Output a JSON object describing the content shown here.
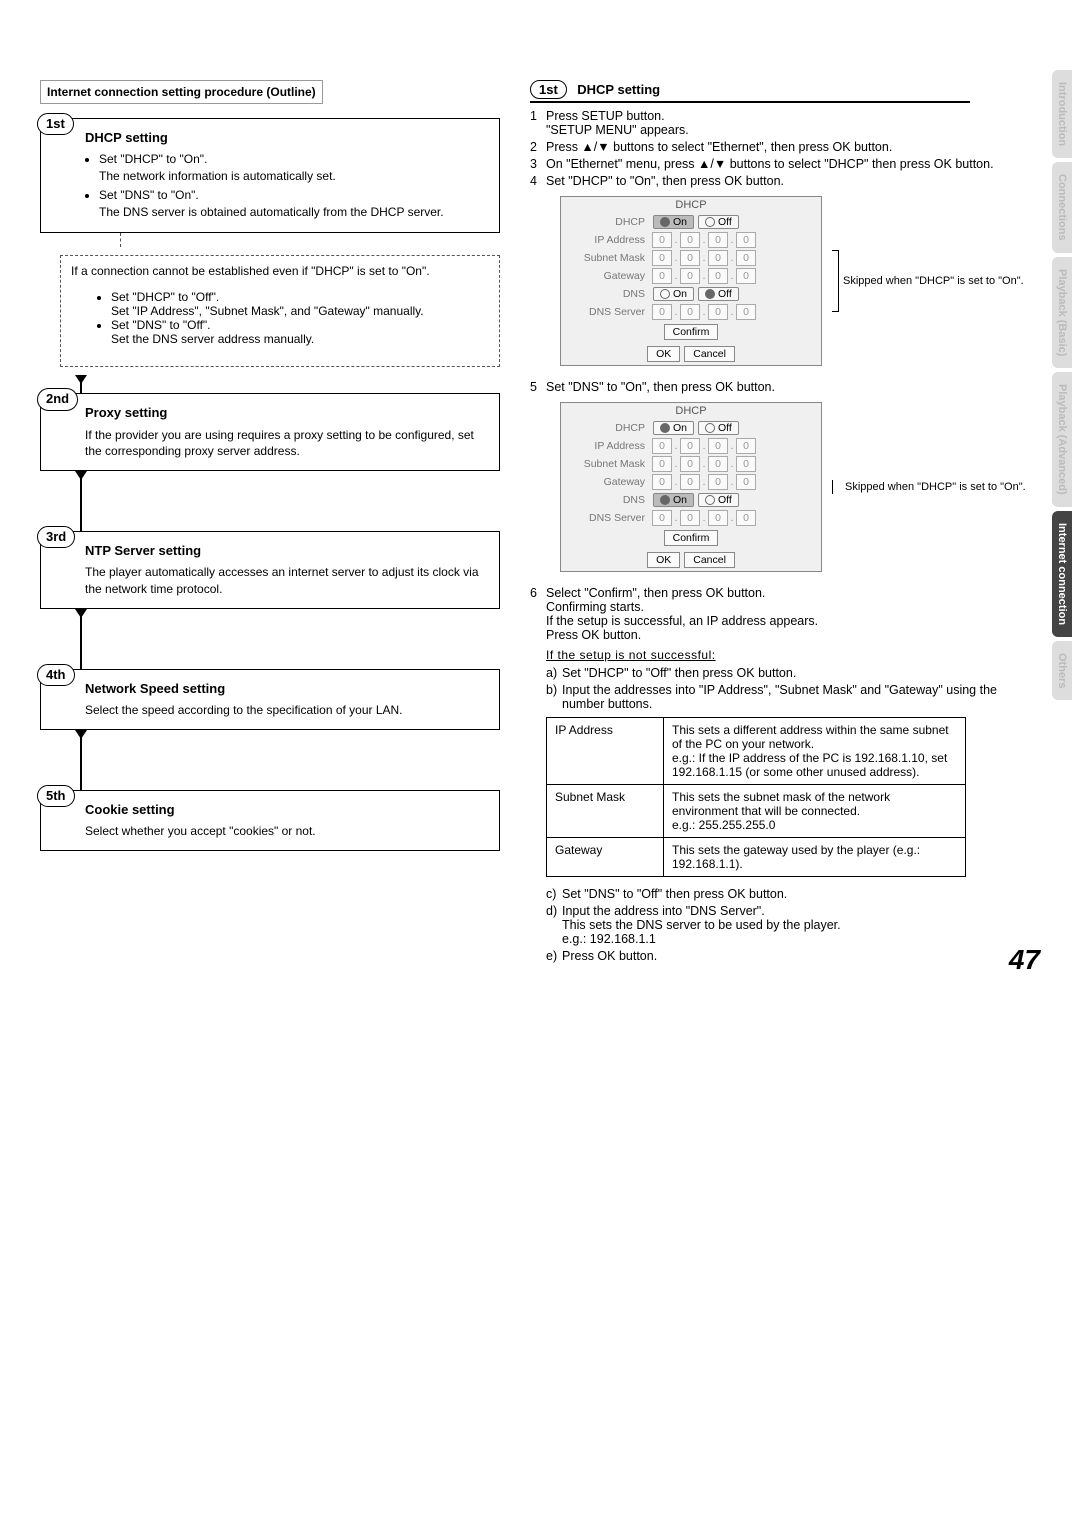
{
  "sideTabs": [
    "Introduction",
    "Connections",
    "Playback (Basic)",
    "Playback (Advanced)",
    "Internet connection",
    "Others"
  ],
  "activeTab": 4,
  "outlineHeader": "Internet connection setting procedure (Outline)",
  "left": {
    "s1": {
      "bubble": "1st",
      "title": "DHCP setting",
      "b1": "Set \"DHCP\" to \"On\".",
      "b1s": "The network information is automatically set.",
      "b2": "Set \"DNS\" to \"On\".",
      "b2s": "The DNS server is obtained automatically from the DHCP server."
    },
    "sub": {
      "intro1": "If a connection cannot be established even if \"DHCP\" is set to \"On\".",
      "i1": "Set \"DHCP\" to \"Off\".",
      "i1s": "Set \"IP Address\", \"Subnet Mask\", and \"Gateway\" manually.",
      "i2": "Set \"DNS\" to \"Off\".",
      "i2s": "Set the DNS server address manually."
    },
    "s2": {
      "bubble": "2nd",
      "title": "Proxy setting",
      "text": "If the provider you are using requires a proxy setting to be configured, set the corresponding proxy server address."
    },
    "s3": {
      "bubble": "3rd",
      "title": "NTP Server setting",
      "text": "The player automatically accesses an internet server to adjust its clock via the network time protocol."
    },
    "s4": {
      "bubble": "4th",
      "title": "Network Speed setting",
      "text": "Select the speed according to the specification of your LAN."
    },
    "s5": {
      "bubble": "5th",
      "title": "Cookie setting",
      "text": "Select whether you accept \"cookies\" or not."
    }
  },
  "right": {
    "head": {
      "bubble": "1st",
      "title": "DHCP setting"
    },
    "steps14": {
      "n1": "1",
      "t1a": "Press SETUP button.",
      "t1b": "\"SETUP MENU\" appears.",
      "n2": "2",
      "t2": "Press ▲/▼ buttons to select \"Ethernet\", then press OK button.",
      "n3": "3",
      "t3": "On \"Ethernet\" menu, press ▲/▼ buttons to select \"DHCP\" then press OK button.",
      "n4": "4",
      "t4": "Set \"DHCP\" to \"On\", then press OK button."
    },
    "panel": {
      "title": "DHCP",
      "labels": {
        "dhcp": "DHCP",
        "ip": "IP Address",
        "mask": "Subnet Mask",
        "gw": "Gateway",
        "dns": "DNS",
        "dnsServer": "DNS Server"
      },
      "opts": {
        "on": "On",
        "off": "Off"
      },
      "seg": "0",
      "btns": {
        "confirm": "Confirm",
        "ok": "OK",
        "cancel": "Cancel"
      },
      "note": "Skipped when \"DHCP\" is set to \"On\"."
    },
    "n5": "5",
    "t5": "Set \"DNS\" to \"On\", then press OK button.",
    "n6": "6",
    "t6a": "Select \"Confirm\", then press OK button.",
    "t6b": "Confirming starts.",
    "t6c": "If the setup is successful, an IP address appears.",
    "t6d": "Press OK button.",
    "failHead": "If the setup is not successful:",
    "fa": "a)",
    "fat": "Set \"DHCP\" to \"Off\" then press OK button.",
    "fb": "b)",
    "fbt": "Input the addresses into \"IP Address\", \"Subnet Mask\" and \"Gateway\" using the number buttons.",
    "table": {
      "r1l": "IP Address",
      "r1t": "This sets a different address within the same subnet of the PC on your network.\ne.g.: If the IP address of the PC is 192.168.1.10, set 192.168.1.15 (or some other unused address).",
      "r2l": "Subnet Mask",
      "r2t": "This sets the subnet mask of the network environment that will be connected.\ne.g.: 255.255.255.0",
      "r3l": "Gateway",
      "r3t": "This sets the gateway used by the player (e.g.: 192.168.1.1)."
    },
    "fc": "c)",
    "fct": "Set \"DNS\" to \"Off\" then press OK button.",
    "fd": "d)",
    "fdt": "Input the address into \"DNS Server\".",
    "fdt2": "This sets the DNS server to be used by the player.",
    "fdt3": "e.g.: 192.168.1.1",
    "fe": "e)",
    "fet": "Press OK button."
  },
  "pageNumber": "47"
}
